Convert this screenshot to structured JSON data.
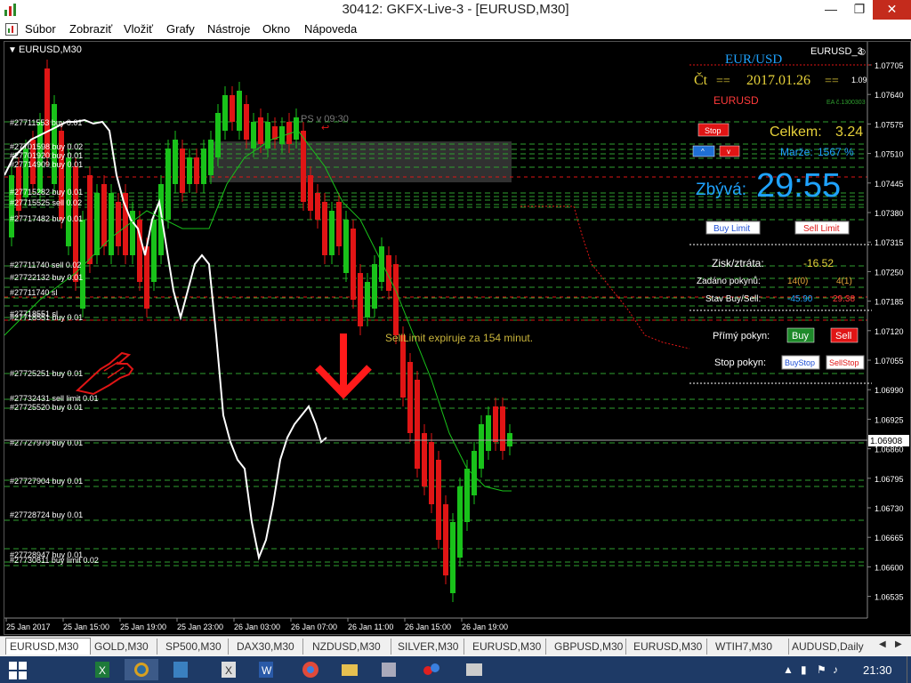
{
  "window": {
    "title": "30412: GKFX-Live-3 - [EURUSD,M30]"
  },
  "menu": [
    "Súbor",
    "Zobraziť",
    "Vložiť",
    "Grafy",
    "Nástroje",
    "Okno",
    "Nápoveda"
  ],
  "chart": {
    "symbol_label": "EURUSD,M30",
    "ea_label": "EURUSD_3",
    "price_axis": [
      "1.07705",
      "1.07640",
      "1.07575",
      "1.07510",
      "1.07445",
      "1.07380",
      "1.07315",
      "1.07250",
      "1.07185",
      "1.07120",
      "1.07055",
      "1.06990",
      "1.06925",
      "1.06860",
      "1.06795",
      "1.06730",
      "1.06665",
      "1.06600",
      "1.06535"
    ],
    "current_price": "1.06908",
    "time_axis": [
      "25 Jan 2017",
      "25 Jan 15:00",
      "25 Jan 19:00",
      "25 Jan 23:00",
      "26 Jan 03:00",
      "26 Jan 07:00",
      "26 Jan 11:00",
      "26 Jan 15:00",
      "26 Jan 19:00"
    ],
    "order_labels": [
      "#27711553 buy 0.01",
      "#27701598 buy 0.02",
      "#27701920 buy 0.01",
      "#27714909 buy 0.01",
      "#27715282 buy 0.01",
      "#27715525 sell 0.02",
      "#27717482 buy 0.01",
      "#27711740 sell 0.02",
      "#27722132 buy 0.01",
      "#27711740 sl",
      "#27718551 sl",
      "#27718551 buy 0.01",
      "#27725251 buy 0.01",
      "#27732431 sell limit 0.01",
      "#27725520 buy 0.01",
      "#27727979 buy 0.01",
      "#27727904 buy 0.01",
      "#27728724 buy 0.01",
      "#27728947 buy 0.01",
      "#27730811 buy limit 0.02"
    ],
    "ps_label": "PS v 09:30",
    "expiry_note": "SellLimit expiruje za 154 minut."
  },
  "panel": {
    "pair": "EUR/USD",
    "day": "Čt",
    "eq1": "==",
    "date": "2017.01.26",
    "eq2": "==",
    "small_value": "1.09",
    "symbol": "EURUSD",
    "ea_version": "EA č.1300303",
    "stop_btn": "Stop",
    "up_btn": "^",
    "down_btn": "v",
    "total_label": "Celkem:",
    "total_value": "3.24",
    "margin_label": "Marže:",
    "margin_value": "1567 %",
    "remain_label": "Zbývá:",
    "remain_time": "29:55",
    "buy_limit_btn": "Buy Limit",
    "sell_limit_btn": "Sell Limit",
    "pnl_label": "Zisk/ztráta:",
    "pnl_value": "-16.52",
    "orders_label": "Zadáno pokynů:",
    "orders_buy": "14(0)",
    "orders_sell": "4(1)",
    "state_label": "Stav Buy/Sell:",
    "state_buy": "-45.90",
    "state_sell": "29.38",
    "direct_label": "Přímý pokyn:",
    "direct_buy": "Buy",
    "direct_sell": "Sell",
    "stop_label": "Stop pokyn:",
    "buystop_btn": "BuyStop",
    "sellstop_btn": "SellStop"
  },
  "tabs": [
    "EURUSD,M30",
    "GOLD,M30",
    "SP500,M30",
    "DAX30,M30",
    "NZDUSD,M30",
    "SILVER,M30",
    "EURUSD,M30",
    "GBPUSD,M30",
    "EURUSD,M30",
    "WTIH7,M30",
    "AUDUSD,Daily"
  ],
  "taskbar": {
    "clock": "21:30"
  },
  "colors": {
    "bull": "#19c21a",
    "bear": "#e01515",
    "level_line": "#2fa02f",
    "white_line": "#ffffff",
    "panel_cyan": "#1fa3ff",
    "panel_yellow": "#e6d13a",
    "panel_red": "#ff2b2b"
  }
}
